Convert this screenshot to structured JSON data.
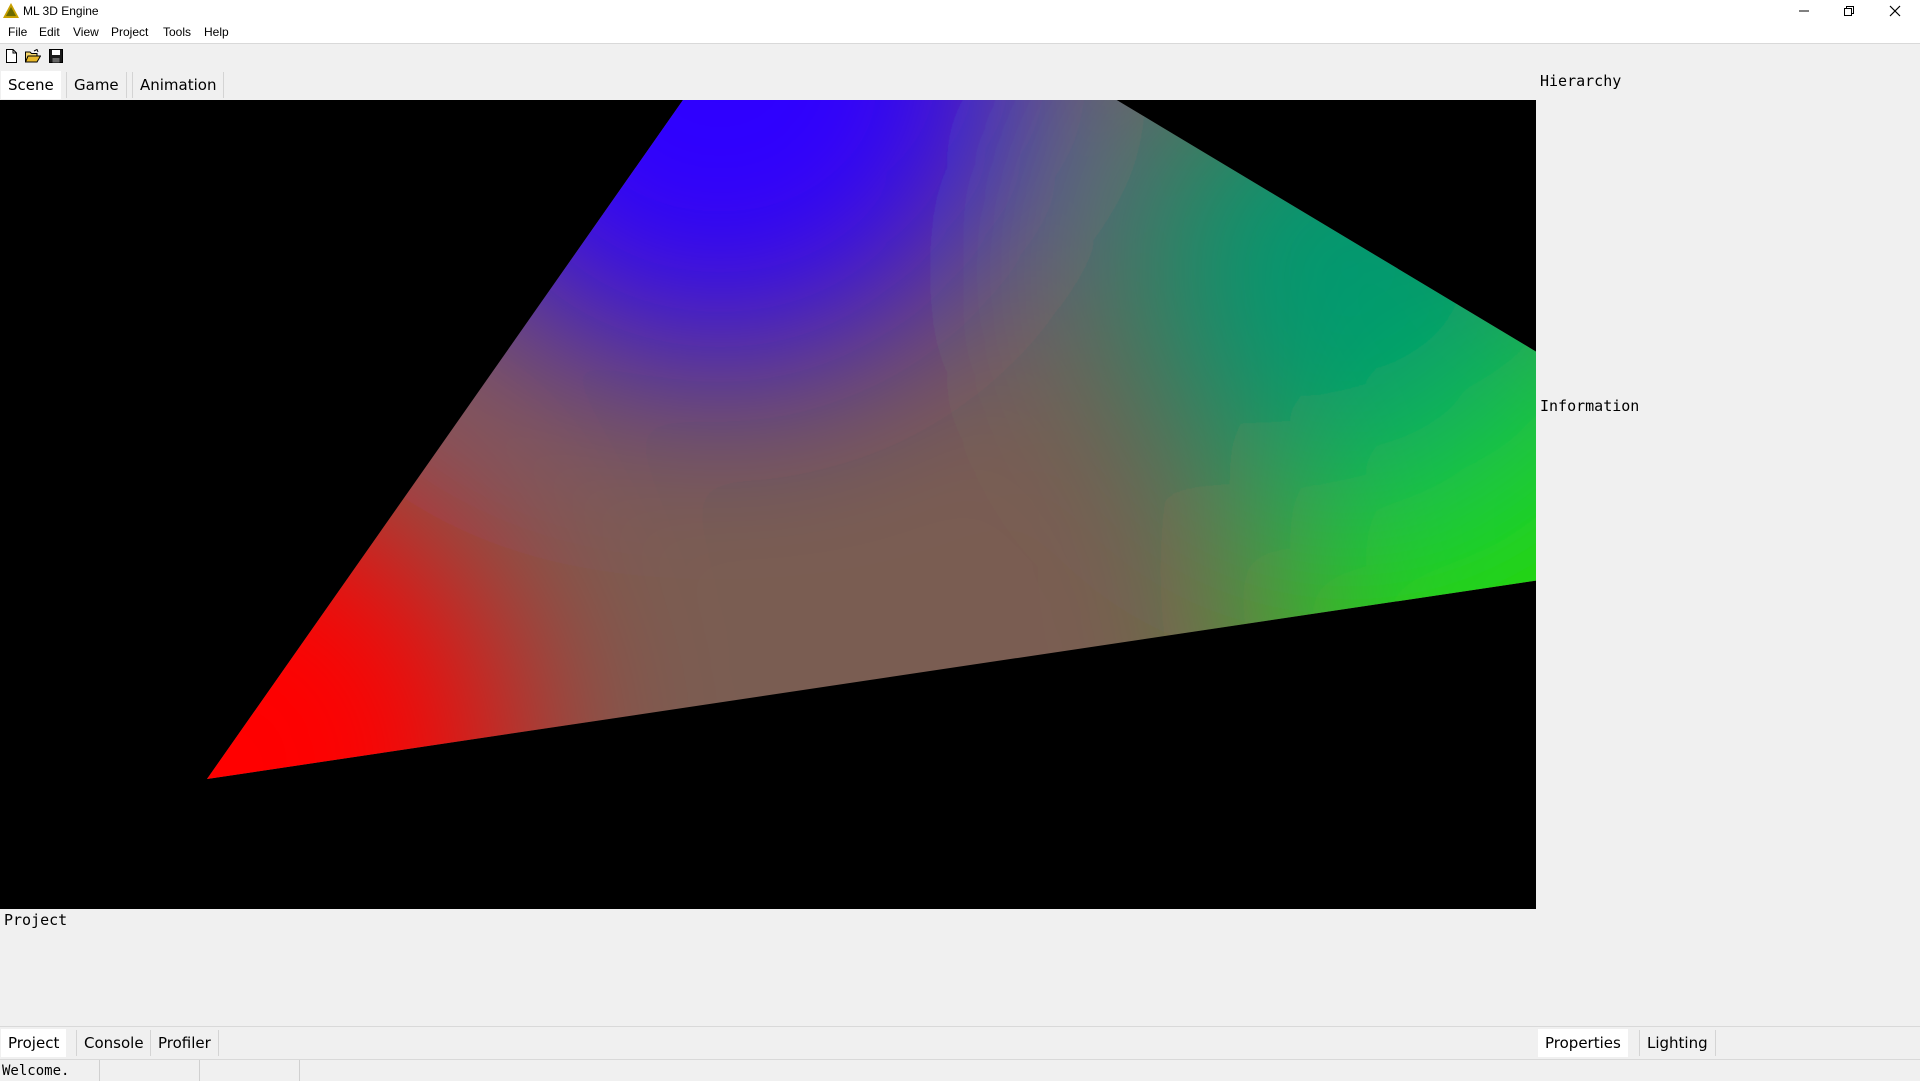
{
  "window": {
    "title": "ML 3D Engine",
    "icons": {
      "app": "triangle-app-icon",
      "minimize": "minimize-icon",
      "restore": "restore-icon",
      "close": "close-icon"
    }
  },
  "menu": [
    "File",
    "Edit",
    "View",
    "Project",
    "Tools",
    "Help"
  ],
  "toolbar": {
    "icons": [
      "new-file-icon",
      "open-folder-icon",
      "save-icon"
    ]
  },
  "scene_tabs": [
    {
      "label": "Scene",
      "active": true
    },
    {
      "label": "Game",
      "active": false
    },
    {
      "label": "Animation",
      "active": false
    }
  ],
  "viewport": {
    "background": "#000000",
    "gradient_colors": {
      "red": "#ff0000",
      "green": "#00ff00",
      "blue": "#0000ff"
    }
  },
  "panels": {
    "hierarchy_title": "Hierarchy",
    "information_title": "Information",
    "project_title": "Project"
  },
  "bottom_tabs": [
    {
      "label": "Project",
      "active": true
    },
    {
      "label": "Console",
      "active": false
    },
    {
      "label": "Profiler",
      "active": false
    }
  ],
  "right_bottom_tabs": [
    {
      "label": "Properties",
      "active": true
    },
    {
      "label": "Lighting",
      "active": false
    }
  ],
  "status": {
    "text": "Welcome."
  }
}
